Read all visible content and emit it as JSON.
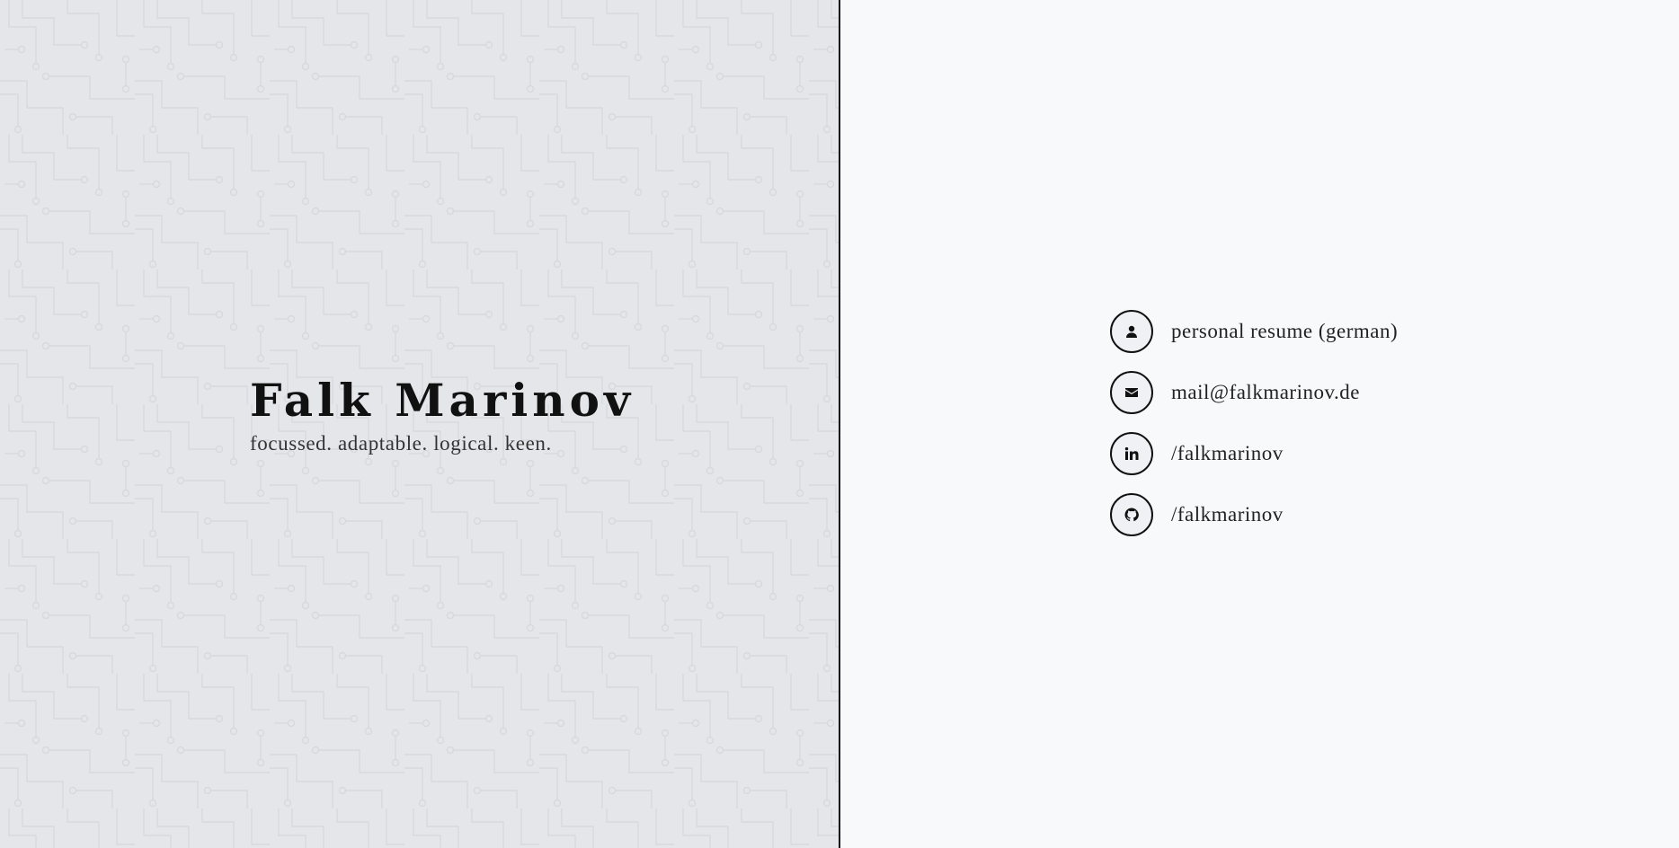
{
  "profile": {
    "name": "Falk Marinov",
    "tagline": "focussed. adaptable. logical. keen."
  },
  "links": [
    {
      "icon": "person-icon",
      "label": "personal resume (german)"
    },
    {
      "icon": "mail-icon",
      "label": "mail@falkmarinov.de"
    },
    {
      "icon": "linkedin-icon",
      "label": "/falkmarinov"
    },
    {
      "icon": "github-icon",
      "label": "/falkmarinov"
    }
  ],
  "colors": {
    "left_background": "#e5e6ea",
    "right_background": "#f8f9fb",
    "circuit_pattern": "#d7d9de",
    "divider": "#111111",
    "text": "#111111"
  }
}
